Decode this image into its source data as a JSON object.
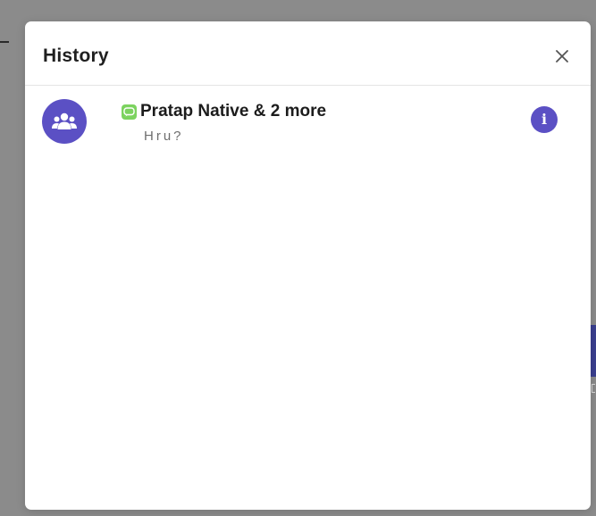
{
  "modal": {
    "title": "History"
  },
  "history": {
    "items": [
      {
        "title": "Pratap Native & 2 more",
        "subtitle": "Hru?",
        "avatar_icon": "group-icon",
        "channel_icon": "chat-bubble-icon",
        "action_icon": "info-icon"
      }
    ]
  },
  "colors": {
    "accent": "#5b50c4",
    "channel_green": "#7cd35f",
    "overlay": "#8b8b8b"
  }
}
